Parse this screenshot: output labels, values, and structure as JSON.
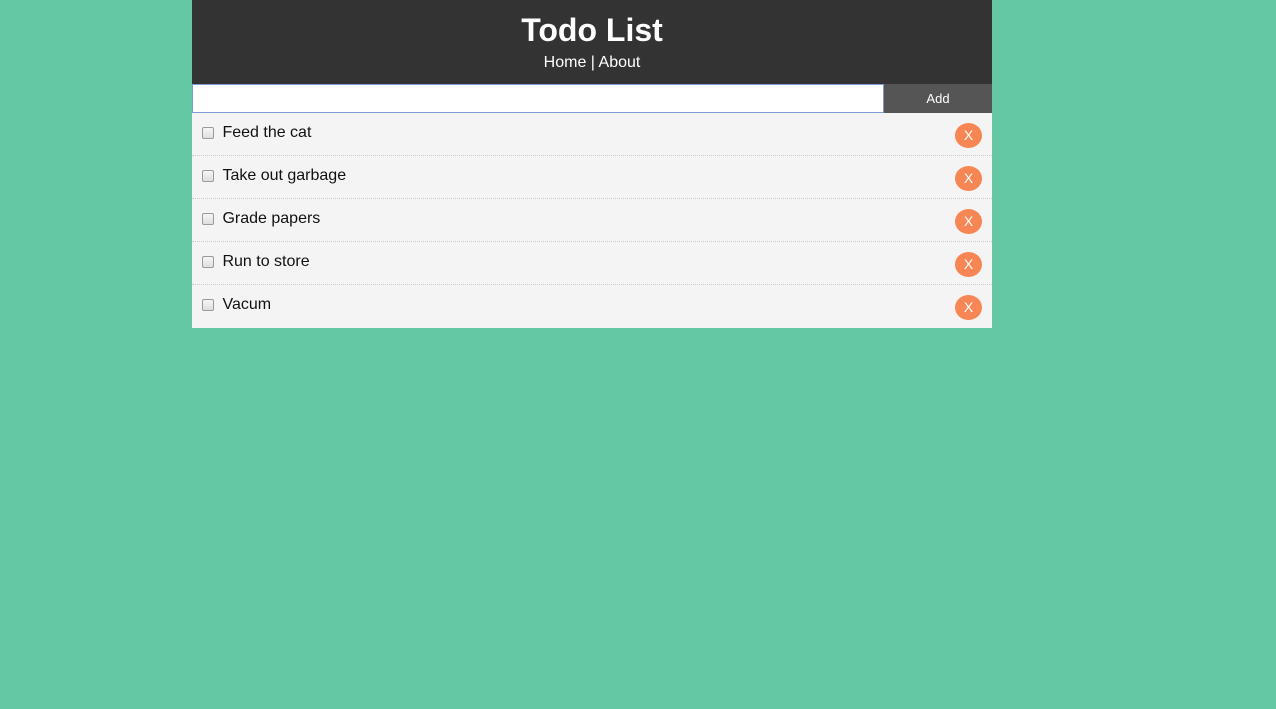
{
  "header": {
    "title": "Todo List",
    "nav": {
      "home_label": "Home",
      "separator": " | ",
      "about_label": "About"
    }
  },
  "add_form": {
    "input_value": "",
    "input_placeholder": "",
    "add_label": "Add"
  },
  "todos": [
    {
      "title": "Feed the cat",
      "completed": false,
      "delete_label": "X"
    },
    {
      "title": "Take out garbage",
      "completed": false,
      "delete_label": "X"
    },
    {
      "title": "Grade papers",
      "completed": false,
      "delete_label": "X"
    },
    {
      "title": "Run to store",
      "completed": false,
      "delete_label": "X"
    },
    {
      "title": "Vacum",
      "completed": false,
      "delete_label": "X"
    }
  ],
  "colors": {
    "page_background": "#64c8a5",
    "header_background": "#333333",
    "item_background": "#f4f4f4",
    "add_button": "#555555",
    "delete_button": "#f68654"
  }
}
